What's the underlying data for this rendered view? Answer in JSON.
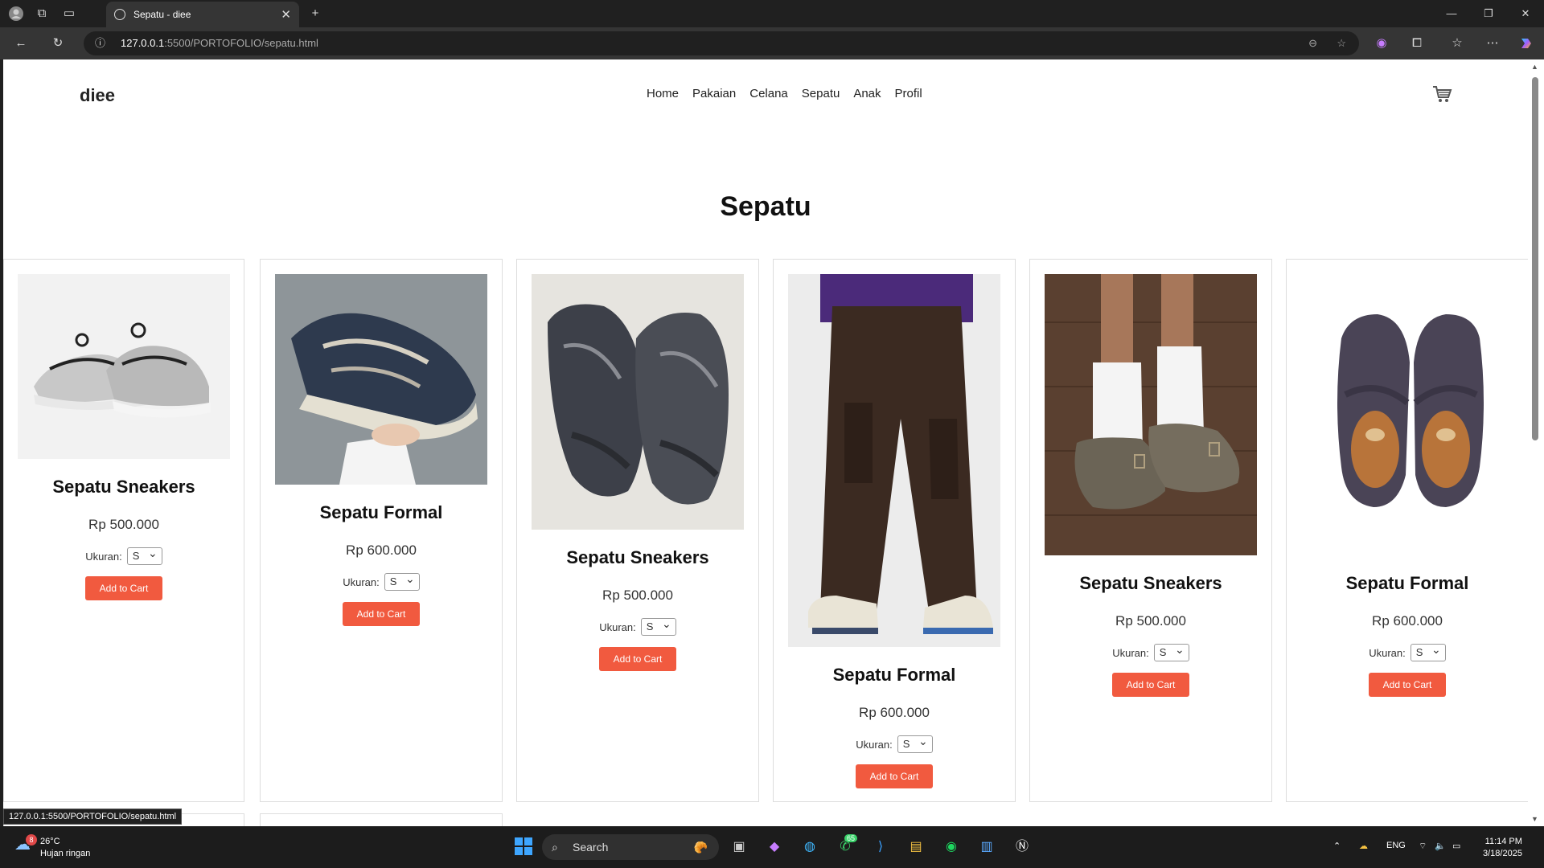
{
  "browser": {
    "tab_title": "Sepatu - diee",
    "url_host": "127.0.0.1",
    "url_path": ":5500/PORTOFOLIO/sepatu.html",
    "status_url": "127.0.0.1:5500/PORTOFOLIO/sepatu.html"
  },
  "site": {
    "logo": "diee",
    "nav": [
      "Home",
      "Pakaian",
      "Celana",
      "Sepatu",
      "Anak",
      "Profil"
    ],
    "page_title": "Sepatu",
    "size_label": "Ukuran:",
    "add_label": "Add to Cart",
    "accent": "#f15a3f"
  },
  "products": [
    {
      "name": "Sepatu Sneakers",
      "price": "Rp 500.000",
      "size": "S",
      "photo": "white silver sneakers"
    },
    {
      "name": "Sepatu Formal",
      "price": "Rp 600.000",
      "size": "S",
      "photo": "navy sneaker held in hand"
    },
    {
      "name": "Sepatu Sneakers",
      "price": "Rp 500.000",
      "size": "S",
      "photo": "grey trail sneakers"
    },
    {
      "name": "Sepatu Formal",
      "price": "Rp 600.000",
      "size": "S",
      "photo": "brown cargo pants with sneakers"
    },
    {
      "name": "Sepatu Sneakers",
      "price": "Rp 500.000",
      "size": "S",
      "photo": "suede clogs with socks"
    },
    {
      "name": "Sepatu Formal",
      "price": "Rp 600.000",
      "size": "S",
      "photo": "purple suede loafers"
    }
  ],
  "taskbar": {
    "weather_temp": "26°C",
    "weather_desc": "Hujan ringan",
    "weather_badge": "8",
    "search": "Search",
    "whatsapp_badge": "65",
    "lang": "ENG",
    "time": "11:14 PM",
    "date": "3/18/2025"
  }
}
